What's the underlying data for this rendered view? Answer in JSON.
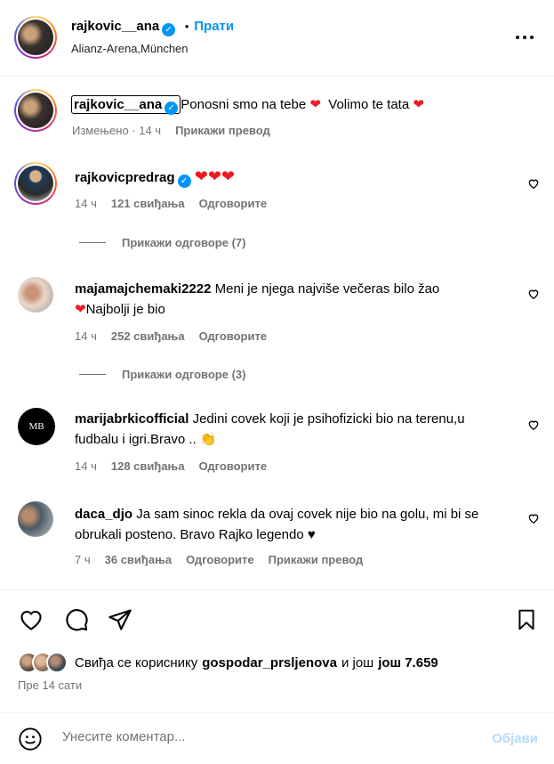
{
  "header": {
    "username": "rajkovic__ana",
    "separator": "•",
    "follow_label": "Прати",
    "location": "Alianz-Arena,München",
    "more_icon": "more-horizontal-icon"
  },
  "caption": {
    "username": "rajkovic__ana",
    "text": "Ponosni smo na tebe",
    "text2": "Volimo te tata",
    "edited": "Измењено · 14 ч",
    "translate": "Прикажи превод"
  },
  "comments": [
    {
      "username": "rajkovicpredrag",
      "text": "",
      "time": "14 ч",
      "likes": "121 свиђања",
      "reply": "Одговорите",
      "view_replies": "Прикажи одговоре (7)"
    },
    {
      "username": "majamajchemaki2222",
      "text": "Meni je njega najviše večeras bilo žao",
      "text2": "Najbolji je bio",
      "time": "14 ч",
      "likes": "252 свиђања",
      "reply": "Одговорите",
      "view_replies": "Прикажи одговоре (3)"
    },
    {
      "username": "marijabrkicofficial",
      "text": "Jedini covek koji je psihofizicki bio na terenu,u fudbalu i igri.Bravo ..",
      "time": "14 ч",
      "likes": "128 свиђања",
      "reply": "Одговорите",
      "avatar_text": "MB"
    },
    {
      "username": "daca_djo",
      "text": "Ja sam sinoc rekla da ovaj covek nije bio na golu, mi bi se obrukali posteno. Bravo Rajko legendo",
      "time": "7 ч",
      "likes": "36 свиђања",
      "reply": "Одговорите",
      "translate": "Прикажи превод"
    }
  ],
  "likes": {
    "prefix": "Свиђа се кориснику",
    "user": "gospodar_prsljenova",
    "middle": "и још",
    "count": "још 7.659"
  },
  "posted": "Пре 14 сати",
  "comment_input": {
    "placeholder": "Унесите коментар...",
    "post_label": "Објави"
  },
  "colors": {
    "accent": "#0095f6",
    "heart": "#ed1c24",
    "muted": "#737373"
  }
}
